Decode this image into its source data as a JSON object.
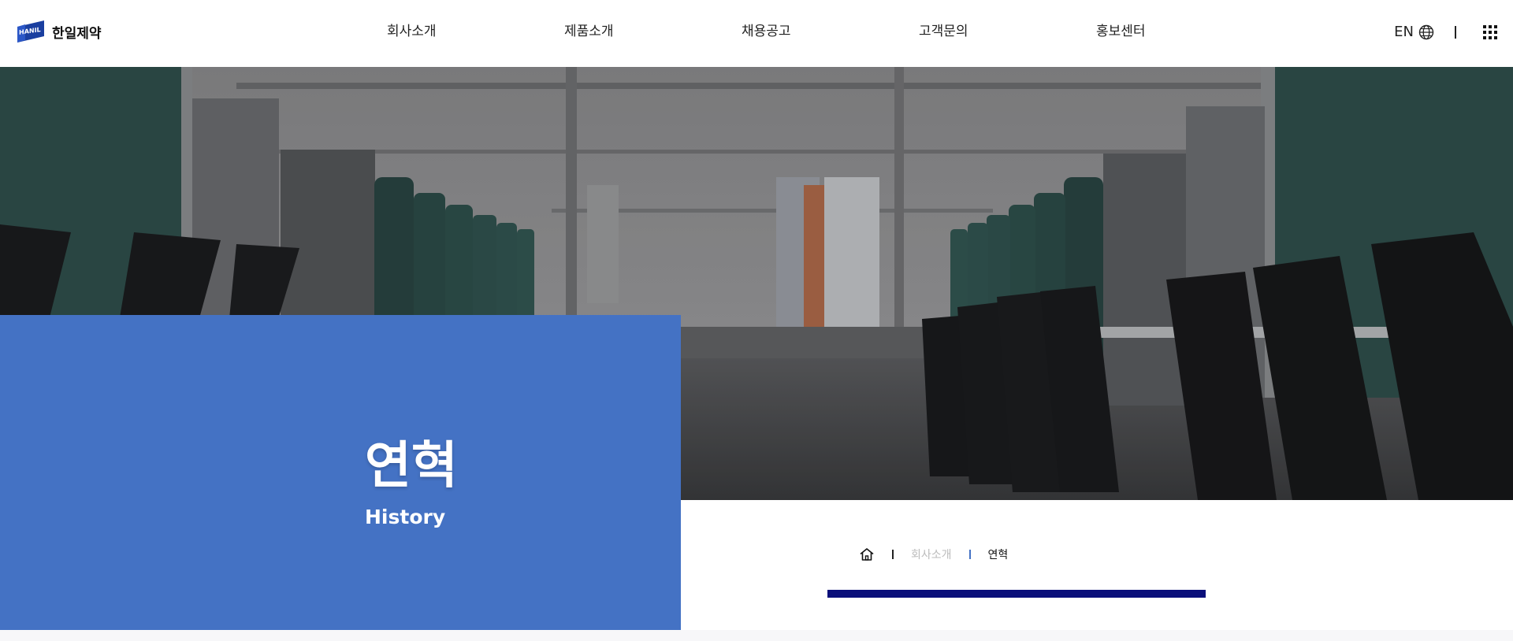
{
  "header": {
    "logo_mark": "HANIL",
    "logo_name": "한일제약",
    "nav": [
      "회사소개",
      "제품소개",
      "채용공고",
      "고객문의",
      "홍보센터"
    ],
    "lang_label": "EN"
  },
  "hero": {
    "title": "연혁",
    "subtitle": "History"
  },
  "breadcrumb": {
    "section": "회사소개",
    "current": "연혁"
  },
  "colors": {
    "accent_blue": "#4472c4",
    "navy": "#0a0f7a",
    "logo_blue": "#1a3fa0"
  },
  "icons": [
    "globe-icon",
    "grid-menu-icon",
    "home-icon"
  ]
}
